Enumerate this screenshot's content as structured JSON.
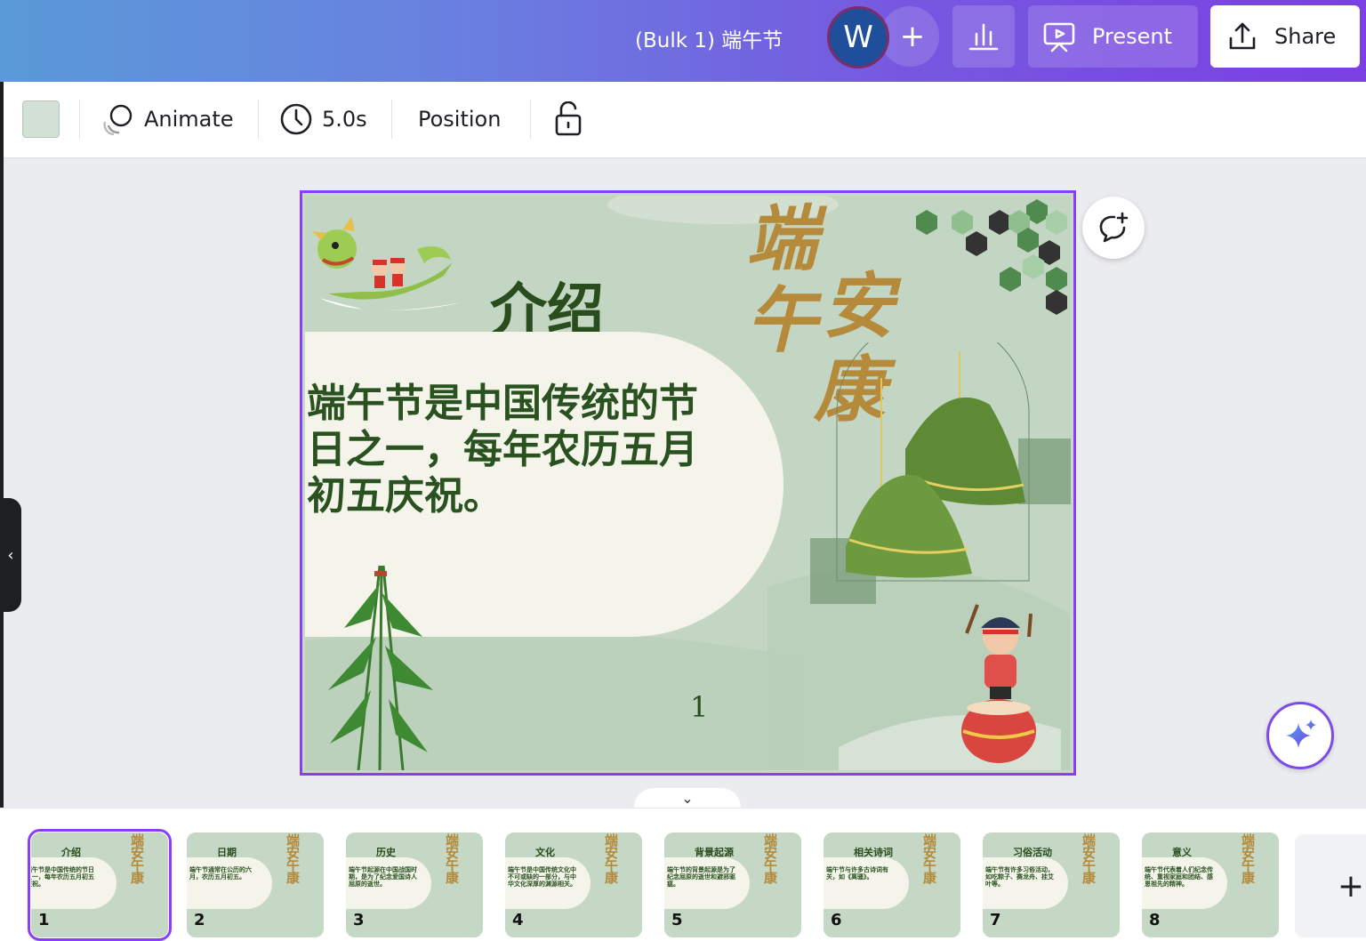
{
  "header": {
    "doc_title": "(Bulk 1) 端午节",
    "avatar_initial": "W",
    "add_collaborator": "+",
    "present_label": "Present",
    "share_label": "Share"
  },
  "toolbar": {
    "swatch_color": "#d3e0d5",
    "animate_label": "Animate",
    "duration_label": "5.0s",
    "position_label": "Position"
  },
  "slide": {
    "title": "介绍",
    "body": "端午节是中国传统的节日之一，每年农历五月初五庆祝。",
    "calligraphy": [
      "端",
      "午",
      "安",
      "康"
    ],
    "page_number": "1"
  },
  "filmstrip": {
    "collapse_icon": "⌄",
    "add_page": "+",
    "thumbnails": [
      {
        "number": "1",
        "title": "介绍",
        "body": "端午节是中国传统的节日之一，每年农历五月初五庆祝。"
      },
      {
        "number": "2",
        "title": "日期",
        "body": "端午节通常在公历的六月，农历五月初五。"
      },
      {
        "number": "3",
        "title": "历史",
        "body": "端午节起源在中国战国时期，是为了纪念爱国诗人屈原的逝世。"
      },
      {
        "number": "4",
        "title": "文化",
        "body": "端午节是中国传统文化中不可或缺的一部分，与中华文化深厚的渊源相关。"
      },
      {
        "number": "5",
        "title": "背景起源",
        "body": "端午节的背景起源是为了纪念屈原的逝世和避邪驱瘟。"
      },
      {
        "number": "6",
        "title": "相关诗词",
        "body": "端午节与许多古诗词有关，如《离骚》。"
      },
      {
        "number": "7",
        "title": "习俗活动",
        "body": "端午节有许多习俗活动，如吃粽子、赛龙舟、挂艾叶等。"
      },
      {
        "number": "8",
        "title": "意义",
        "body": "端午节代表着人们纪念传统、重视家庭和团结、感恩祖先的精神。"
      }
    ]
  },
  "colors": {
    "accent": "#8b3dff",
    "slide_bg": "#c3d5c3",
    "title_green": "#2a4d1e",
    "gold": "#b58a3a"
  }
}
